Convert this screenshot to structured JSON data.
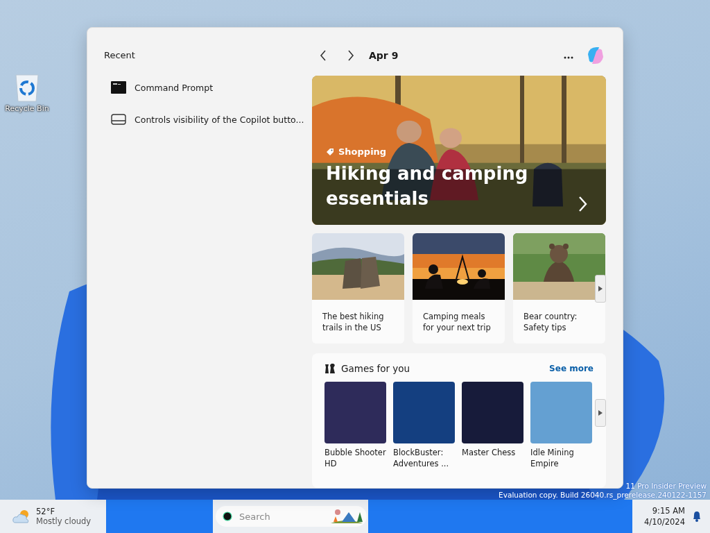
{
  "desktop": {
    "icons": [
      {
        "label": "Recycle Bin"
      }
    ],
    "watermark": [
      "11 Pro Insider Preview",
      "Evaluation copy. Build 26040.rs_prerelease.240122-1157"
    ]
  },
  "widgets": {
    "recent": {
      "title": "Recent",
      "items": [
        {
          "kind": "console",
          "label": "Command Prompt"
        },
        {
          "kind": "window",
          "label": "Controls visibility of the Copilot butto..."
        }
      ]
    },
    "header": {
      "date": "Apr 9"
    },
    "hero": {
      "category": "Shopping",
      "title": "Hiking and camping essentials"
    },
    "stories": [
      {
        "kind": "boots",
        "title": "The best hiking trails in the US"
      },
      {
        "kind": "campfire",
        "title": "Camping meals for your next trip"
      },
      {
        "kind": "bear",
        "title": "Bear country: Safety tips"
      }
    ],
    "games": {
      "title": "Games for you",
      "see_more": "See more",
      "items": [
        {
          "title": "Bubble Shooter HD",
          "color": "#2e2b5a"
        },
        {
          "title": "BlockBuster: Adventures ...",
          "color": "#143f80"
        },
        {
          "title": "Master Chess",
          "color": "#171b3a"
        },
        {
          "title": "Idle Mining Empire",
          "color": "#64a0d2"
        }
      ]
    }
  },
  "taskbar": {
    "weather": {
      "temperature": "52°F",
      "condition": "Mostly cloudy"
    },
    "search": {
      "placeholder": "Search"
    },
    "clock": {
      "time": "9:15 AM",
      "date": "4/10/2024"
    }
  }
}
